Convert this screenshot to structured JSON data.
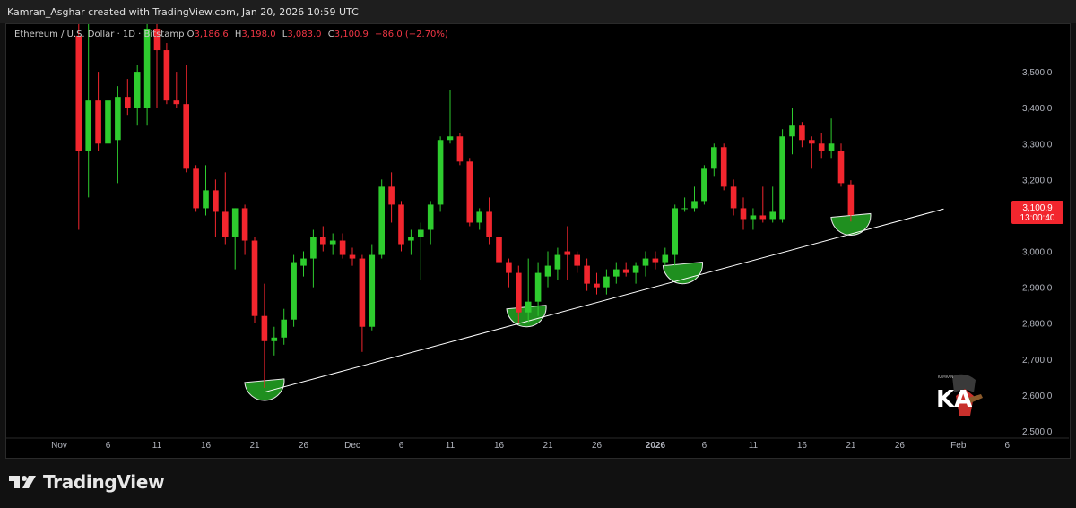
{
  "header": {
    "text": "Kamran_Asghar created with TradingView.com, Jan 20, 2026 10:59 UTC"
  },
  "legend": {
    "symbol": "Ethereum / U.S. Dollar · 1D · Bitstamp",
    "o_label": "O",
    "o_value": "3,186.6",
    "h_label": "H",
    "h_value": "3,198.0",
    "l_label": "L",
    "l_value": "3,083.0",
    "c_label": "C",
    "c_value": "3,100.9",
    "change": "−86.0 (−2.70%)"
  },
  "price_tag": {
    "price": "3,100.9",
    "countdown": "13:00:40"
  },
  "footer": {
    "brand": "TradingView"
  },
  "watermark": {
    "text": "KA",
    "small": "KAMRAN"
  },
  "colors": {
    "up": "#2ecc2e",
    "down": "#f2262e",
    "background": "#000000",
    "trendline": "#ffffff",
    "zone": "#1f8f1f"
  },
  "chart_data": {
    "type": "candlestick",
    "ylim": [
      2500,
      3600
    ],
    "y_ticks": [
      "2,500.0",
      "2,600.0",
      "2,700.0",
      "2,800.0",
      "2,900.0",
      "3,000.0",
      "3,100.0",
      "3,200.0",
      "3,300.0",
      "3,400.0",
      "3,500.0"
    ],
    "y_tick_values": [
      2500,
      2600,
      2700,
      2800,
      2900,
      3000,
      3100,
      3200,
      3300,
      3400,
      3500
    ],
    "x_ticks": [
      {
        "label": "Nov",
        "day": 0
      },
      {
        "label": "6",
        "day": 5
      },
      {
        "label": "11",
        "day": 10
      },
      {
        "label": "16",
        "day": 15
      },
      {
        "label": "21",
        "day": 20
      },
      {
        "label": "26",
        "day": 25
      },
      {
        "label": "Dec",
        "day": 30
      },
      {
        "label": "6",
        "day": 35
      },
      {
        "label": "11",
        "day": 40
      },
      {
        "label": "16",
        "day": 45
      },
      {
        "label": "21",
        "day": 50
      },
      {
        "label": "26",
        "day": 55
      },
      {
        "label": "2026",
        "day": 61
      },
      {
        "label": "6",
        "day": 66
      },
      {
        "label": "11",
        "day": 71
      },
      {
        "label": "16",
        "day": 76
      },
      {
        "label": "21",
        "day": 81
      },
      {
        "label": "26",
        "day": 86
      },
      {
        "label": "Feb",
        "day": 92
      },
      {
        "label": "6",
        "day": 97
      }
    ],
    "candles": [
      {
        "day": 2,
        "o": 3600,
        "h": 3680,
        "l": 3060,
        "c": 3280
      },
      {
        "day": 3,
        "o": 3280,
        "h": 3650,
        "l": 3150,
        "c": 3420
      },
      {
        "day": 4,
        "o": 3420,
        "h": 3500,
        "l": 3280,
        "c": 3300
      },
      {
        "day": 5,
        "o": 3300,
        "h": 3450,
        "l": 3180,
        "c": 3420
      },
      {
        "day": 6,
        "o": 3310,
        "h": 3460,
        "l": 3190,
        "c": 3430
      },
      {
        "day": 7,
        "o": 3430,
        "h": 3480,
        "l": 3380,
        "c": 3400
      },
      {
        "day": 8,
        "o": 3400,
        "h": 3520,
        "l": 3350,
        "c": 3500
      },
      {
        "day": 9,
        "o": 3400,
        "h": 3700,
        "l": 3350,
        "c": 3620
      },
      {
        "day": 10,
        "o": 3620,
        "h": 3700,
        "l": 3400,
        "c": 3560
      },
      {
        "day": 11,
        "o": 3560,
        "h": 3580,
        "l": 3410,
        "c": 3420
      },
      {
        "day": 12,
        "o": 3420,
        "h": 3500,
        "l": 3400,
        "c": 3410
      },
      {
        "day": 13,
        "o": 3410,
        "h": 3520,
        "l": 3220,
        "c": 3230
      },
      {
        "day": 14,
        "o": 3230,
        "h": 3240,
        "l": 3110,
        "c": 3120
      },
      {
        "day": 15,
        "o": 3120,
        "h": 3240,
        "l": 3100,
        "c": 3170
      },
      {
        "day": 16,
        "o": 3170,
        "h": 3200,
        "l": 3040,
        "c": 3110
      },
      {
        "day": 17,
        "o": 3110,
        "h": 3220,
        "l": 3020,
        "c": 3040
      },
      {
        "day": 18,
        "o": 3040,
        "h": 3120,
        "l": 2950,
        "c": 3120
      },
      {
        "day": 19,
        "o": 3120,
        "h": 3130,
        "l": 2990,
        "c": 3030
      },
      {
        "day": 20,
        "o": 3030,
        "h": 3040,
        "l": 2800,
        "c": 2820
      },
      {
        "day": 21,
        "o": 2820,
        "h": 2910,
        "l": 2620,
        "c": 2750
      },
      {
        "day": 22,
        "o": 2750,
        "h": 2790,
        "l": 2710,
        "c": 2760
      },
      {
        "day": 23,
        "o": 2760,
        "h": 2840,
        "l": 2740,
        "c": 2810
      },
      {
        "day": 24,
        "o": 2810,
        "h": 2990,
        "l": 2790,
        "c": 2970
      },
      {
        "day": 25,
        "o": 2960,
        "h": 3000,
        "l": 2930,
        "c": 2980
      },
      {
        "day": 26,
        "o": 2980,
        "h": 3060,
        "l": 2900,
        "c": 3040
      },
      {
        "day": 27,
        "o": 3040,
        "h": 3070,
        "l": 3000,
        "c": 3020
      },
      {
        "day": 28,
        "o": 3020,
        "h": 3050,
        "l": 2990,
        "c": 3030
      },
      {
        "day": 29,
        "o": 3030,
        "h": 3050,
        "l": 2980,
        "c": 2990
      },
      {
        "day": 30,
        "o": 2990,
        "h": 3010,
        "l": 2960,
        "c": 2980
      },
      {
        "day": 31,
        "o": 2980,
        "h": 2990,
        "l": 2720,
        "c": 2790
      },
      {
        "day": 32,
        "o": 2790,
        "h": 3020,
        "l": 2780,
        "c": 2990
      },
      {
        "day": 33,
        "o": 2990,
        "h": 3200,
        "l": 2980,
        "c": 3180
      },
      {
        "day": 34,
        "o": 3180,
        "h": 3220,
        "l": 3080,
        "c": 3130
      },
      {
        "day": 35,
        "o": 3130,
        "h": 3140,
        "l": 3000,
        "c": 3020
      },
      {
        "day": 36,
        "o": 3030,
        "h": 3060,
        "l": 2990,
        "c": 3040
      },
      {
        "day": 37,
        "o": 3040,
        "h": 3080,
        "l": 2920,
        "c": 3060
      },
      {
        "day": 38,
        "o": 3060,
        "h": 3140,
        "l": 3020,
        "c": 3130
      },
      {
        "day": 39,
        "o": 3130,
        "h": 3320,
        "l": 3110,
        "c": 3310
      },
      {
        "day": 40,
        "o": 3310,
        "h": 3450,
        "l": 3300,
        "c": 3320
      },
      {
        "day": 41,
        "o": 3320,
        "h": 3330,
        "l": 3240,
        "c": 3250
      },
      {
        "day": 42,
        "o": 3250,
        "h": 3260,
        "l": 3070,
        "c": 3080
      },
      {
        "day": 43,
        "o": 3080,
        "h": 3120,
        "l": 3060,
        "c": 3110
      },
      {
        "day": 44,
        "o": 3110,
        "h": 3150,
        "l": 3020,
        "c": 3040
      },
      {
        "day": 45,
        "o": 3040,
        "h": 3160,
        "l": 2950,
        "c": 2970
      },
      {
        "day": 46,
        "o": 2970,
        "h": 2980,
        "l": 2900,
        "c": 2940
      },
      {
        "day": 47,
        "o": 2940,
        "h": 2960,
        "l": 2800,
        "c": 2830
      },
      {
        "day": 48,
        "o": 2830,
        "h": 2980,
        "l": 2800,
        "c": 2860
      },
      {
        "day": 49,
        "o": 2860,
        "h": 2970,
        "l": 2820,
        "c": 2940
      },
      {
        "day": 50,
        "o": 2930,
        "h": 3000,
        "l": 2900,
        "c": 2960
      },
      {
        "day": 51,
        "o": 2950,
        "h": 3010,
        "l": 2920,
        "c": 2990
      },
      {
        "day": 52,
        "o": 3000,
        "h": 3070,
        "l": 2920,
        "c": 2990
      },
      {
        "day": 53,
        "o": 2990,
        "h": 3000,
        "l": 2940,
        "c": 2960
      },
      {
        "day": 54,
        "o": 2960,
        "h": 2980,
        "l": 2890,
        "c": 2910
      },
      {
        "day": 55,
        "o": 2910,
        "h": 2940,
        "l": 2880,
        "c": 2900
      },
      {
        "day": 56,
        "o": 2900,
        "h": 2950,
        "l": 2880,
        "c": 2930
      },
      {
        "day": 57,
        "o": 2930,
        "h": 2970,
        "l": 2910,
        "c": 2950
      },
      {
        "day": 58,
        "o": 2950,
        "h": 2970,
        "l": 2930,
        "c": 2940
      },
      {
        "day": 59,
        "o": 2940,
        "h": 2970,
        "l": 2910,
        "c": 2960
      },
      {
        "day": 60,
        "o": 2960,
        "h": 3000,
        "l": 2930,
        "c": 2980
      },
      {
        "day": 61,
        "o": 2980,
        "h": 3000,
        "l": 2950,
        "c": 2970
      },
      {
        "day": 62,
        "o": 2970,
        "h": 3010,
        "l": 2960,
        "c": 2990
      },
      {
        "day": 63,
        "o": 2990,
        "h": 3130,
        "l": 2960,
        "c": 3120
      },
      {
        "day": 64,
        "o": 3120,
        "h": 3150,
        "l": 3110,
        "c": 3120
      },
      {
        "day": 65,
        "o": 3120,
        "h": 3180,
        "l": 3110,
        "c": 3140
      },
      {
        "day": 66,
        "o": 3140,
        "h": 3240,
        "l": 3130,
        "c": 3230
      },
      {
        "day": 67,
        "o": 3230,
        "h": 3300,
        "l": 3210,
        "c": 3290
      },
      {
        "day": 68,
        "o": 3290,
        "h": 3300,
        "l": 3170,
        "c": 3180
      },
      {
        "day": 69,
        "o": 3180,
        "h": 3200,
        "l": 3100,
        "c": 3120
      },
      {
        "day": 70,
        "o": 3120,
        "h": 3150,
        "l": 3060,
        "c": 3090
      },
      {
        "day": 71,
        "o": 3090,
        "h": 3120,
        "l": 3060,
        "c": 3100
      },
      {
        "day": 72,
        "o": 3100,
        "h": 3180,
        "l": 3080,
        "c": 3090
      },
      {
        "day": 73,
        "o": 3090,
        "h": 3180,
        "l": 3080,
        "c": 3110
      },
      {
        "day": 74,
        "o": 3090,
        "h": 3340,
        "l": 3080,
        "c": 3320
      },
      {
        "day": 75,
        "o": 3320,
        "h": 3400,
        "l": 3270,
        "c": 3350
      },
      {
        "day": 76,
        "o": 3350,
        "h": 3360,
        "l": 3290,
        "c": 3310
      },
      {
        "day": 77,
        "o": 3310,
        "h": 3320,
        "l": 3230,
        "c": 3300
      },
      {
        "day": 78,
        "o": 3300,
        "h": 3330,
        "l": 3260,
        "c": 3280
      },
      {
        "day": 79,
        "o": 3280,
        "h": 3370,
        "l": 3260,
        "c": 3300
      },
      {
        "day": 80,
        "o": 3280,
        "h": 3300,
        "l": 3180,
        "c": 3190
      },
      {
        "day": 81,
        "o": 3186.6,
        "h": 3198,
        "l": 3083,
        "c": 3100.9
      }
    ],
    "trendline": {
      "x1_day": 21.0,
      "y1": 2608,
      "x2_day": 90.5,
      "y2": 3118
    },
    "zones": [
      {
        "day": 21.0,
        "center_price": 2625
      },
      {
        "day": 47.8,
        "center_price": 2830
      },
      {
        "day": 63.8,
        "center_price": 2950
      },
      {
        "day": 81.0,
        "center_price": 3085
      }
    ],
    "current_price": 3100.9
  }
}
